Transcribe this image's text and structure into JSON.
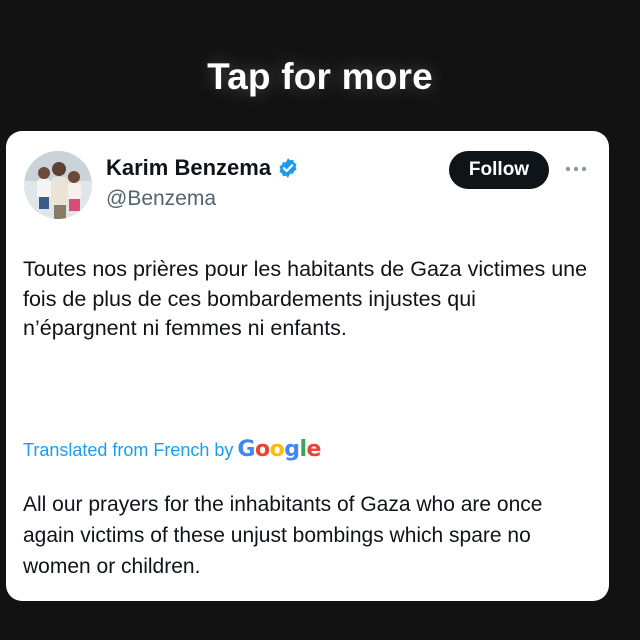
{
  "overlay": {
    "tap_label": "Tap for more"
  },
  "tweet": {
    "display_name": "Karim Benzema",
    "handle": "@Benzema",
    "follow_label": "Follow",
    "text": "Toutes nos prières pour les habitants de Gaza victimes une fois de plus de ces bombardements injustes qui n’épargnent ni femmes ni enfants.",
    "translated_prefix": "Translated from French by",
    "translator_logo": "Google",
    "translation": "All our prayers for the inhabitants of Gaza who are once again victims of these unjust bombings which spare no women or children."
  },
  "icons": {
    "verified": "verified-badge-icon",
    "more": "more-options-icon"
  },
  "colors": {
    "background": "#121212",
    "card": "#ffffff",
    "text": "#0f1419",
    "secondary_text": "#536471",
    "link": "#1d9bf0",
    "verified": "#1d9bf0",
    "follow_button": "#0f1419"
  }
}
